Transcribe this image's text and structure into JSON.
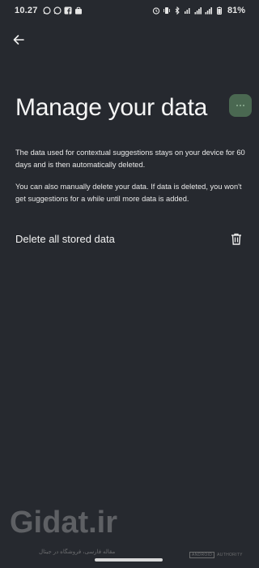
{
  "status_bar": {
    "time": "10.27",
    "battery": "81%"
  },
  "header": {
    "back_icon": "arrow-back-icon"
  },
  "main": {
    "title": "Manage your data",
    "paragraphs": [
      "The data used for contextual suggestions stays on your device for 60 days and is then automatically deleted.",
      "You can also manually delete your data. If data is deleted, you won't get suggestions for a while until more data is added."
    ],
    "delete_row": {
      "label": "Delete all stored data",
      "icon": "trash-icon"
    }
  },
  "watermark": {
    "logo_text": "Gidat.ir",
    "subtext": "مقاله فارسی، فروشگاه در جیتال",
    "authority_box": "ANDROID",
    "authority_text": "AUTHORITY"
  },
  "colors": {
    "background": "#26292f",
    "text": "#f2f2f2"
  }
}
